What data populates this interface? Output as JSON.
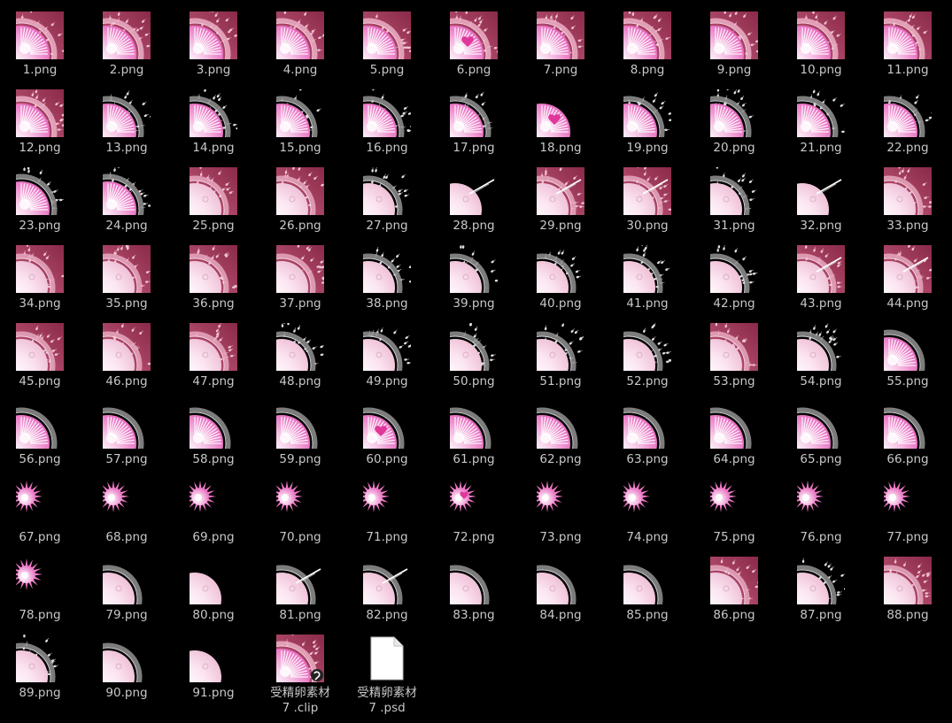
{
  "files": [
    {
      "name": "1.png",
      "bg": "maroon",
      "fig": "egg"
    },
    {
      "name": "2.png",
      "bg": "maroon",
      "fig": "egg"
    },
    {
      "name": "3.png",
      "bg": "maroon",
      "fig": "egg"
    },
    {
      "name": "4.png",
      "bg": "maroon",
      "fig": "egg"
    },
    {
      "name": "5.png",
      "bg": "maroon",
      "fig": "egg"
    },
    {
      "name": "6.png",
      "bg": "maroon",
      "fig": "egg-heart"
    },
    {
      "name": "7.png",
      "bg": "maroon",
      "fig": "egg"
    },
    {
      "name": "8.png",
      "bg": "maroon",
      "fig": "egg"
    },
    {
      "name": "9.png",
      "bg": "maroon",
      "fig": "egg"
    },
    {
      "name": "10.png",
      "bg": "maroon",
      "fig": "egg"
    },
    {
      "name": "11.png",
      "bg": "maroon",
      "fig": "egg"
    },
    {
      "name": "12.png",
      "bg": "maroon",
      "fig": "egg"
    },
    {
      "name": "13.png",
      "bg": "black",
      "fig": "egg-sperm"
    },
    {
      "name": "14.png",
      "bg": "black",
      "fig": "egg-sperm"
    },
    {
      "name": "15.png",
      "bg": "black",
      "fig": "egg-sperm"
    },
    {
      "name": "16.png",
      "bg": "black",
      "fig": "egg-sperm"
    },
    {
      "name": "17.png",
      "bg": "black",
      "fig": "egg-sperm"
    },
    {
      "name": "18.png",
      "bg": "black",
      "fig": "egg-heart"
    },
    {
      "name": "19.png",
      "bg": "black",
      "fig": "egg-sperm"
    },
    {
      "name": "20.png",
      "bg": "black",
      "fig": "egg-sperm"
    },
    {
      "name": "21.png",
      "bg": "black",
      "fig": "egg-sperm"
    },
    {
      "name": "22.png",
      "bg": "black",
      "fig": "egg-sperm"
    },
    {
      "name": "23.png",
      "bg": "black",
      "fig": "egg-sperm"
    },
    {
      "name": "24.png",
      "bg": "black",
      "fig": "egg-sperm"
    },
    {
      "name": "25.png",
      "bg": "maroon",
      "fig": "pale"
    },
    {
      "name": "26.png",
      "bg": "maroon",
      "fig": "pale"
    },
    {
      "name": "27.png",
      "bg": "black",
      "fig": "pale-sperm"
    },
    {
      "name": "28.png",
      "bg": "black",
      "fig": "pale-streak"
    },
    {
      "name": "29.png",
      "bg": "maroon",
      "fig": "pale-streak"
    },
    {
      "name": "30.png",
      "bg": "maroon",
      "fig": "pale-streak"
    },
    {
      "name": "31.png",
      "bg": "black",
      "fig": "pale-sperm"
    },
    {
      "name": "32.png",
      "bg": "black",
      "fig": "pale-streak"
    },
    {
      "name": "33.png",
      "bg": "maroon",
      "fig": "pale"
    },
    {
      "name": "34.png",
      "bg": "maroon",
      "fig": "pale"
    },
    {
      "name": "35.png",
      "bg": "maroon",
      "fig": "pale"
    },
    {
      "name": "36.png",
      "bg": "maroon",
      "fig": "pale"
    },
    {
      "name": "37.png",
      "bg": "maroon",
      "fig": "pale"
    },
    {
      "name": "38.png",
      "bg": "black",
      "fig": "pale-sperm"
    },
    {
      "name": "39.png",
      "bg": "black",
      "fig": "pale-sperm"
    },
    {
      "name": "40.png",
      "bg": "black",
      "fig": "pale-sperm"
    },
    {
      "name": "41.png",
      "bg": "black",
      "fig": "pale-sperm"
    },
    {
      "name": "42.png",
      "bg": "black",
      "fig": "pale-sperm"
    },
    {
      "name": "43.png",
      "bg": "maroon",
      "fig": "pale-streak"
    },
    {
      "name": "44.png",
      "bg": "maroon",
      "fig": "pale-streak"
    },
    {
      "name": "45.png",
      "bg": "maroon",
      "fig": "pale"
    },
    {
      "name": "46.png",
      "bg": "maroon",
      "fig": "pale"
    },
    {
      "name": "47.png",
      "bg": "maroon",
      "fig": "pale"
    },
    {
      "name": "48.png",
      "bg": "black",
      "fig": "pale-sperm"
    },
    {
      "name": "49.png",
      "bg": "black",
      "fig": "pale-sperm"
    },
    {
      "name": "50.png",
      "bg": "black",
      "fig": "pale-sperm"
    },
    {
      "name": "51.png",
      "bg": "black",
      "fig": "pale-sperm"
    },
    {
      "name": "52.png",
      "bg": "black",
      "fig": "pale-sperm"
    },
    {
      "name": "53.png",
      "bg": "maroon",
      "fig": "pale"
    },
    {
      "name": "54.png",
      "bg": "black",
      "fig": "pale-sperm"
    },
    {
      "name": "55.png",
      "bg": "none",
      "fig": "egg-ring"
    },
    {
      "name": "56.png",
      "bg": "none",
      "fig": "egg-ring"
    },
    {
      "name": "57.png",
      "bg": "none",
      "fig": "egg-ring"
    },
    {
      "name": "58.png",
      "bg": "none",
      "fig": "egg-ring"
    },
    {
      "name": "59.png",
      "bg": "none",
      "fig": "egg-ring"
    },
    {
      "name": "60.png",
      "bg": "none",
      "fig": "egg-ring-heart"
    },
    {
      "name": "61.png",
      "bg": "none",
      "fig": "egg-ring"
    },
    {
      "name": "62.png",
      "bg": "none",
      "fig": "egg-ring"
    },
    {
      "name": "63.png",
      "bg": "none",
      "fig": "egg-ring"
    },
    {
      "name": "64.png",
      "bg": "none",
      "fig": "egg-ring"
    },
    {
      "name": "65.png",
      "bg": "none",
      "fig": "egg-ring"
    },
    {
      "name": "66.png",
      "bg": "none",
      "fig": "egg-ring"
    },
    {
      "name": "67.png",
      "bg": "none",
      "fig": "burst"
    },
    {
      "name": "68.png",
      "bg": "none",
      "fig": "burst"
    },
    {
      "name": "69.png",
      "bg": "none",
      "fig": "burst"
    },
    {
      "name": "70.png",
      "bg": "none",
      "fig": "burst"
    },
    {
      "name": "71.png",
      "bg": "none",
      "fig": "burst"
    },
    {
      "name": "72.png",
      "bg": "none",
      "fig": "burst-heart"
    },
    {
      "name": "73.png",
      "bg": "none",
      "fig": "burst"
    },
    {
      "name": "74.png",
      "bg": "none",
      "fig": "burst"
    },
    {
      "name": "75.png",
      "bg": "none",
      "fig": "burst"
    },
    {
      "name": "76.png",
      "bg": "none",
      "fig": "burst"
    },
    {
      "name": "77.png",
      "bg": "none",
      "fig": "burst"
    },
    {
      "name": "78.png",
      "bg": "none",
      "fig": "burst"
    },
    {
      "name": "79.png",
      "bg": "none",
      "fig": "pale-ring"
    },
    {
      "name": "80.png",
      "bg": "none",
      "fig": "pale-plain"
    },
    {
      "name": "81.png",
      "bg": "none",
      "fig": "pale-ring-streak"
    },
    {
      "name": "82.png",
      "bg": "none",
      "fig": "pale-ring-streak"
    },
    {
      "name": "83.png",
      "bg": "none",
      "fig": "pale-ring"
    },
    {
      "name": "84.png",
      "bg": "none",
      "fig": "pale-ring"
    },
    {
      "name": "85.png",
      "bg": "none",
      "fig": "pale-ring"
    },
    {
      "name": "86.png",
      "bg": "maroon",
      "fig": "pale"
    },
    {
      "name": "87.png",
      "bg": "black",
      "fig": "pale-sperm"
    },
    {
      "name": "88.png",
      "bg": "maroon",
      "fig": "pale"
    },
    {
      "name": "89.png",
      "bg": "black",
      "fig": "pale-sperm"
    },
    {
      "name": "90.png",
      "bg": "none",
      "fig": "pale-ring"
    },
    {
      "name": "91.png",
      "bg": "none",
      "fig": "pale-plain"
    },
    {
      "name": "受精卵素材\n7 .clip",
      "bg": "maroon",
      "fig": "clip"
    },
    {
      "name": "受精卵素材\n7 .psd",
      "bg": "none",
      "fig": "doc"
    }
  ],
  "icons": {
    "image": "image-thumbnail-icon",
    "clip": "clip-studio-file-icon",
    "doc": "blank-document-icon"
  }
}
